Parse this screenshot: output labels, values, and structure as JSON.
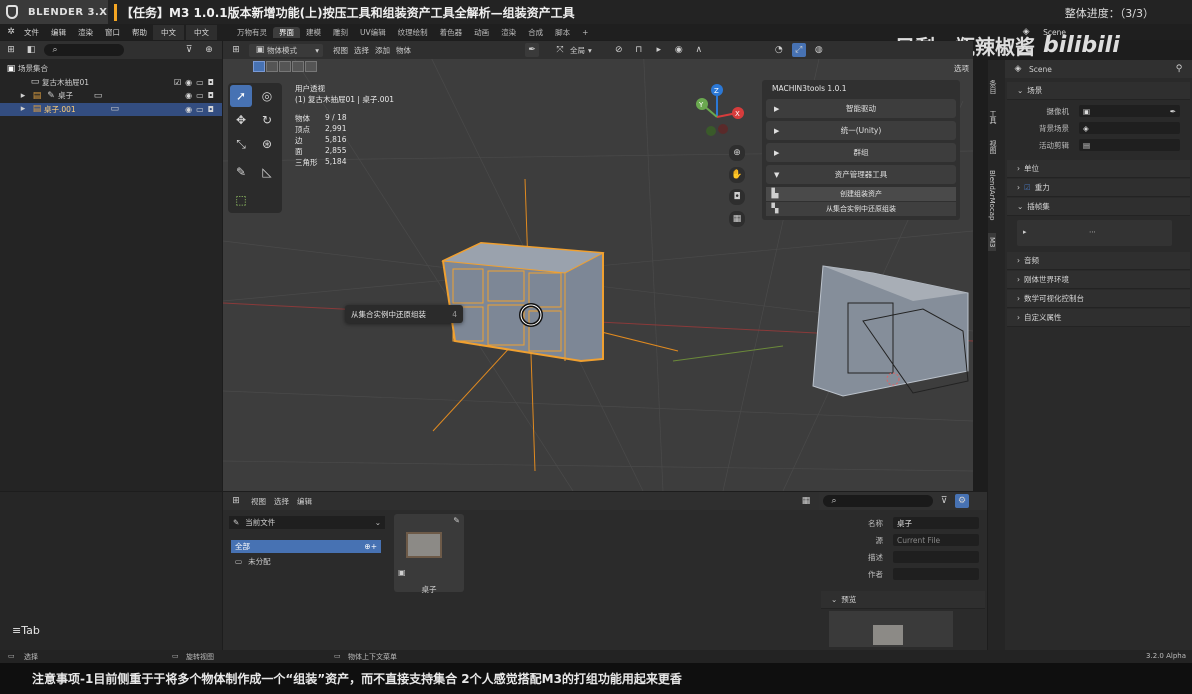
{
  "app": {
    "name": "BLENDER 3.X",
    "version": "3.2.0 Alpha"
  },
  "task_title": "【任务】M3 1.0.1版本新增功能(上)按压工具和组装资产工具全解析—组装资产工具",
  "progress": "整体进度：（3/3）",
  "watermark": "只剩一瓶辣椒酱",
  "watermark_logo": "bilibili",
  "menu": [
    "文件",
    "编辑",
    "渲染",
    "窗口",
    "帮助",
    "中文",
    "中文"
  ],
  "workspaces": [
    "万物有灵",
    "界面",
    "建模",
    "雕刻",
    "UV编辑",
    "纹理绘制",
    "着色器",
    "动画",
    "渲染",
    "合成",
    "脚本",
    "+"
  ],
  "scene_name": "Scene",
  "outliner": {
    "title": "场景集合",
    "items": [
      {
        "label": "复古木抽屉01",
        "selected": false
      },
      {
        "label": "桌子",
        "selected": false
      },
      {
        "label": "桌子.001",
        "selected": true
      }
    ]
  },
  "viewport": {
    "mode": "物体模式",
    "menus": [
      "视图",
      "选择",
      "添加",
      "物体"
    ],
    "orientation": "全局",
    "options_label": "选项",
    "view_name": "用户透视",
    "view_object": "(1) 复古木抽屉01 | 桌子.001",
    "stats": [
      {
        "k": "物体",
        "v": "9 / 18"
      },
      {
        "k": "顶点",
        "v": "2,991"
      },
      {
        "k": "边",
        "v": "5,816"
      },
      {
        "k": "面",
        "v": "2,855"
      },
      {
        "k": "三角形",
        "v": "5,184"
      }
    ],
    "tooltip": {
      "text": "从集合实例中还原组装",
      "key": "4"
    },
    "gizmo": {
      "x": "X",
      "y": "Y",
      "z": "Z"
    }
  },
  "m3panel": {
    "title": "MACHIN3tools 1.0.1",
    "buttons": [
      "智能驱动",
      "统一(Unity)",
      "群组",
      "资产管理器工具"
    ],
    "sub": [
      "创建组装资产",
      "从集合实例中还原组装"
    ]
  },
  "ntabs": [
    "条目",
    "工具",
    "视图",
    "BlendArMocap",
    "M3"
  ],
  "properties": {
    "header": "Scene",
    "section": "场景",
    "fields": [
      {
        "k": "摄像机",
        "v": ""
      },
      {
        "k": "背景场景",
        "v": ""
      },
      {
        "k": "活动剪辑",
        "v": ""
      }
    ],
    "sections": [
      "单位",
      "重力",
      "插帧集",
      "音频",
      "刚体世界环境",
      "数学可视化控制台",
      "自定义属性"
    ]
  },
  "asset_browser": {
    "menus": [
      "视图",
      "选择",
      "编辑"
    ],
    "library": "当前文件",
    "categories": [
      "全部",
      "未分配"
    ],
    "asset_name": "桌子",
    "details": [
      {
        "k": "名称",
        "v": "桌子"
      },
      {
        "k": "源",
        "v": "Current File"
      },
      {
        "k": "描述",
        "v": ""
      },
      {
        "k": "作者",
        "v": ""
      }
    ],
    "preview_label": "预览"
  },
  "tab_label": "≡Tab",
  "status": {
    "left": "选择",
    "mid": "旋转视图",
    "right": "物体上下文菜单"
  },
  "subtitle": "注意事项-1目前侧重于于将多个物体制作成一个“组装”资产，而不直接支持集合 2个人感觉搭配M3的打组功能用起来更香"
}
